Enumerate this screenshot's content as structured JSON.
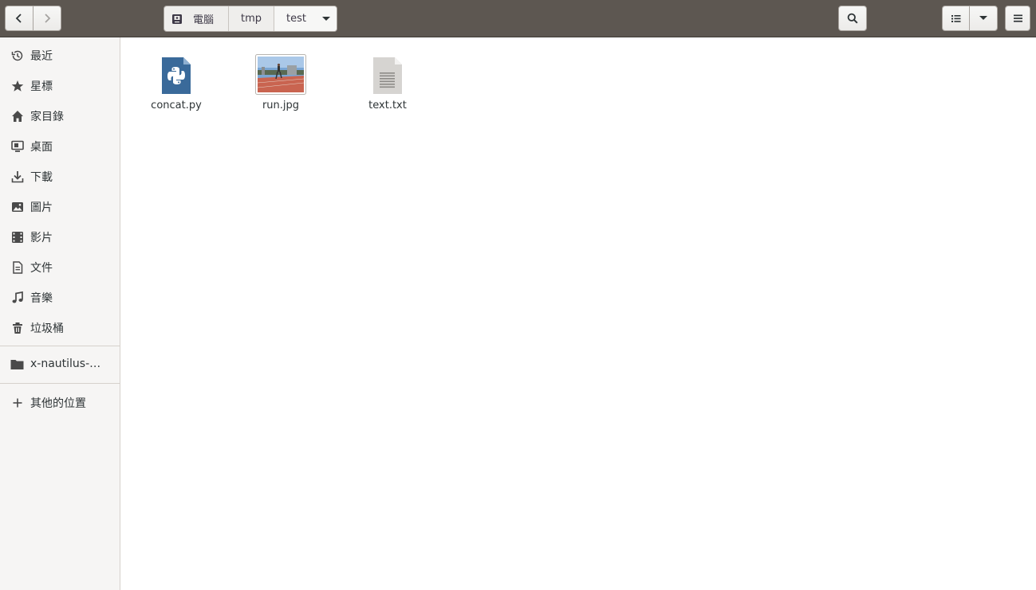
{
  "header": {
    "path": [
      {
        "label": "電腦",
        "icon": "computer-icon"
      },
      {
        "label": "tmp"
      },
      {
        "label": "test"
      }
    ]
  },
  "sidebar": {
    "places": [
      {
        "label": "最近",
        "icon": "recent-icon"
      },
      {
        "label": "星標",
        "icon": "star-icon"
      },
      {
        "label": "家目錄",
        "icon": "home-icon"
      },
      {
        "label": "桌面",
        "icon": "desktop-icon"
      },
      {
        "label": "下載",
        "icon": "download-icon"
      },
      {
        "label": "圖片",
        "icon": "pictures-icon"
      },
      {
        "label": "影片",
        "icon": "videos-icon"
      },
      {
        "label": "文件",
        "icon": "documents-icon"
      },
      {
        "label": "音樂",
        "icon": "music-icon"
      },
      {
        "label": "垃圾桶",
        "icon": "trash-icon"
      }
    ],
    "bookmarks": [
      {
        "label": "x-nautilus-de…",
        "icon": "folder-icon"
      }
    ],
    "other": {
      "label": "其他的位置",
      "icon": "plus-icon"
    }
  },
  "files": [
    {
      "name": "concat.py",
      "icon": "python-file-icon"
    },
    {
      "name": "run.jpg",
      "icon": "image-thumbnail"
    },
    {
      "name": "text.txt",
      "icon": "text-file-icon"
    }
  ],
  "colors": {
    "headerbar": "#5d5751",
    "sidebar": "#f6f5f4",
    "python_icon": "#3a6a9a",
    "track": "#c96450"
  }
}
